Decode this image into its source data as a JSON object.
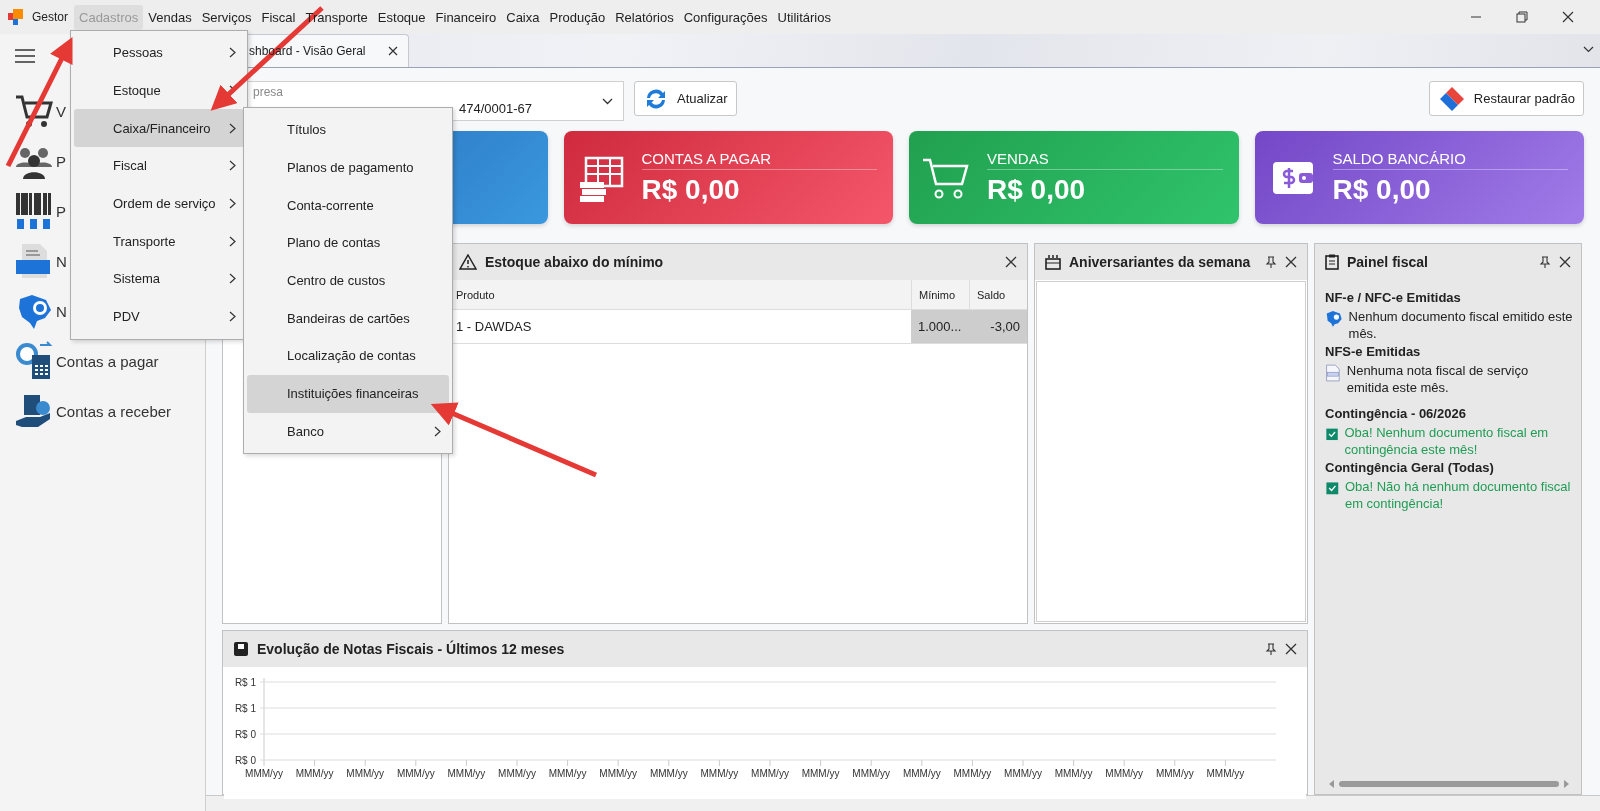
{
  "menubar": {
    "app": "Gestor",
    "items": [
      {
        "label": "Cadastros",
        "selected": true
      },
      {
        "label": "Vendas",
        "selected": false
      },
      {
        "label": "Serviços",
        "selected": false
      },
      {
        "label": "Fiscal",
        "selected": false
      },
      {
        "label": "Transporte",
        "selected": false
      },
      {
        "label": "Estoque",
        "selected": false
      },
      {
        "label": "Financeiro",
        "selected": false
      },
      {
        "label": "Caixa",
        "selected": false
      },
      {
        "label": "Produção",
        "selected": false
      },
      {
        "label": "Relatórios",
        "selected": false
      },
      {
        "label": "Configurações",
        "selected": false
      },
      {
        "label": "Utilitários",
        "selected": false
      }
    ]
  },
  "menu": [
    {
      "label": "Pessoas",
      "selected": false,
      "submenu": true
    },
    {
      "label": "Estoque",
      "selected": false,
      "submenu": true
    },
    {
      "label": "Caixa/Financeiro",
      "selected": true,
      "submenu": true
    },
    {
      "label": "Fiscal",
      "selected": false,
      "submenu": true
    },
    {
      "label": "Ordem de serviço",
      "selected": false,
      "submenu": true
    },
    {
      "label": "Transporte",
      "selected": false,
      "submenu": true
    },
    {
      "label": "Sistema",
      "selected": false,
      "submenu": true
    },
    {
      "label": "PDV",
      "selected": false,
      "submenu": true
    }
  ],
  "submenu": [
    {
      "label": "Títulos",
      "selected": false,
      "submenu": false
    },
    {
      "label": "Planos de pagamento",
      "selected": false,
      "submenu": false
    },
    {
      "label": "Conta-corrente",
      "selected": false,
      "submenu": false
    },
    {
      "label": "Plano de contas",
      "selected": false,
      "submenu": false
    },
    {
      "label": "Centro de custos",
      "selected": false,
      "submenu": false
    },
    {
      "label": "Bandeiras de cartões",
      "selected": false,
      "submenu": false
    },
    {
      "label": "Localização de contas",
      "selected": false,
      "submenu": false
    },
    {
      "label": "Instituições financeiras",
      "selected": true,
      "submenu": false
    },
    {
      "label": "Banco",
      "selected": false,
      "submenu": true
    }
  ],
  "sidebar": {
    "items": [
      {
        "kind": "cart",
        "label": "V"
      },
      {
        "kind": "people",
        "label": "P"
      },
      {
        "kind": "barcode",
        "label": "P"
      },
      {
        "kind": "nfse",
        "label": "N"
      },
      {
        "kind": "nfe",
        "label": "N"
      },
      {
        "kind": "pay",
        "label": "Contas a pagar"
      },
      {
        "kind": "receive",
        "label": "Contas a receber"
      }
    ]
  },
  "tab": {
    "label": "shboard - Visão Geral"
  },
  "company_field": {
    "label": "presa",
    "value": "474/0001-67"
  },
  "refresh_button": "Atualizar",
  "restore_button": "Restaurar padrão",
  "cards": [
    {
      "kind": "blue"
    },
    {
      "kind": "payable",
      "title": "CONTAS A PAGAR",
      "value": "R$ 0,00"
    },
    {
      "kind": "sales",
      "title": "VENDAS",
      "value": "R$ 0,00"
    },
    {
      "kind": "bank",
      "title": "SALDO BANCÁRIO",
      "value": "R$ 0,00"
    }
  ],
  "stock_panel": {
    "title": "Estoque abaixo do mínimo",
    "columns": [
      "Produto",
      "Mínimo",
      "Saldo"
    ],
    "rows": [
      [
        "1 - DAWDAS",
        "1.000...",
        "-3,00"
      ]
    ]
  },
  "birthday_panel": {
    "title": "Aniversariantes da semana"
  },
  "fiscal_panel": {
    "title": "Painel fiscal",
    "sections": [
      {
        "heading": "NF-e / NFC-e Emitidas",
        "kind": "nfe",
        "message": "Nenhum documento fiscal emitido este mês."
      },
      {
        "heading": "NFS-e Emitidas",
        "kind": "nfse",
        "message": "Nenhuma nota fiscal de serviço emitida este mês."
      },
      {
        "heading": "Contingência - 06/2026",
        "kind": "ok",
        "message": "Oba! Nenhum documento fiscal em contingência este mês!"
      },
      {
        "heading": "Contingência Geral (Todas)",
        "kind": "ok",
        "message": "Oba! Não há nenhum documento fiscal em contingência!"
      }
    ]
  },
  "chart_panel": {
    "title": "Evolução de Notas Fiscais - Últimos 12 meses",
    "y_axis_labels": [
      "R$ 1",
      "R$ 1",
      "R$ 0",
      "R$ 0"
    ],
    "chart_data": {
      "type": "other",
      "categories": [
        "MMM/yy",
        "MMM/yy",
        "MMM/yy",
        "MMM/yy",
        "MMM/yy",
        "MMM/yy",
        "MMM/yy",
        "MMM/yy",
        "MMM/yy",
        "MMM/yy",
        "MMM/yy",
        "MMM/yy",
        "MMM/yy",
        "MMM/yy",
        "MMM/yy",
        "MMM/yy",
        "MMM/yy",
        "MMM/yy",
        "MMM/yy",
        "MMM/yy"
      ]
    }
  }
}
